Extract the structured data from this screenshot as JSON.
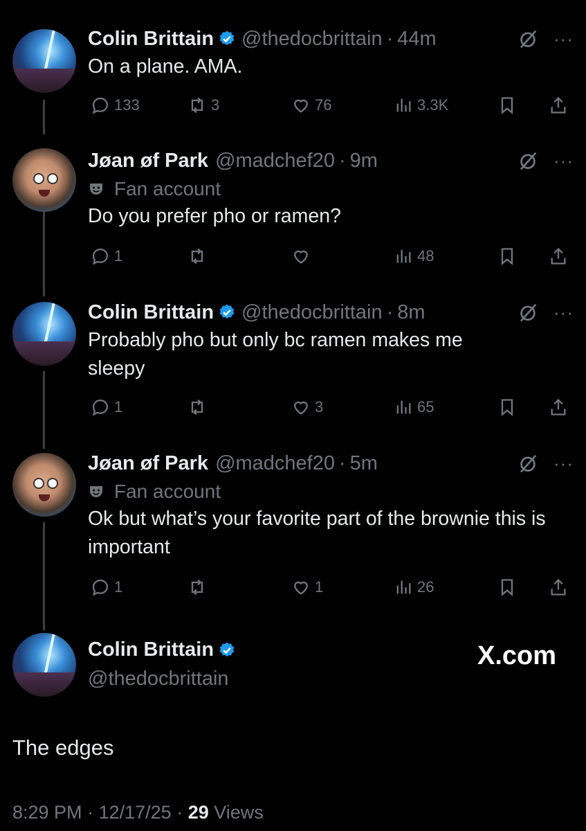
{
  "tweets": [
    {
      "name": "Colin Brittain",
      "verified": true,
      "handle": "@thedocbrittain",
      "time": "44m",
      "body": "On a plane.  AMA.",
      "replies": "133",
      "reposts": "3",
      "likes": "76",
      "views": "3.3K"
    },
    {
      "name": "Jøan øf Park",
      "verified": false,
      "handle": "@madchef20",
      "time": "9m",
      "badge": "Fan account",
      "body": "Do you prefer pho or ramen?",
      "replies": "1",
      "reposts": "",
      "likes": "",
      "views": "48"
    },
    {
      "name": "Colin Brittain",
      "verified": true,
      "handle": "@thedocbrittain",
      "time": "8m",
      "body": "Probably pho but only bc ramen makes me sleepy",
      "replies": "1",
      "reposts": "",
      "likes": "3",
      "views": "65"
    },
    {
      "name": "Jøan øf Park",
      "verified": false,
      "handle": "@madchef20",
      "time": "5m",
      "badge": "Fan account",
      "body": "Ok but what’s your favorite part of the brownie this is important",
      "replies": "1",
      "reposts": "",
      "likes": "1",
      "views": "26"
    }
  ],
  "final": {
    "name": "Colin Brittain",
    "handle": "@thedocbrittain",
    "site": "X.com",
    "text": "The edges",
    "time": "8:29 PM",
    "date": "12/17/25",
    "views_count": "29",
    "views_label": "Views"
  },
  "colors": {
    "verified": "#1d9bf0",
    "muted": "#71767b",
    "text": "#e7e9ea"
  }
}
